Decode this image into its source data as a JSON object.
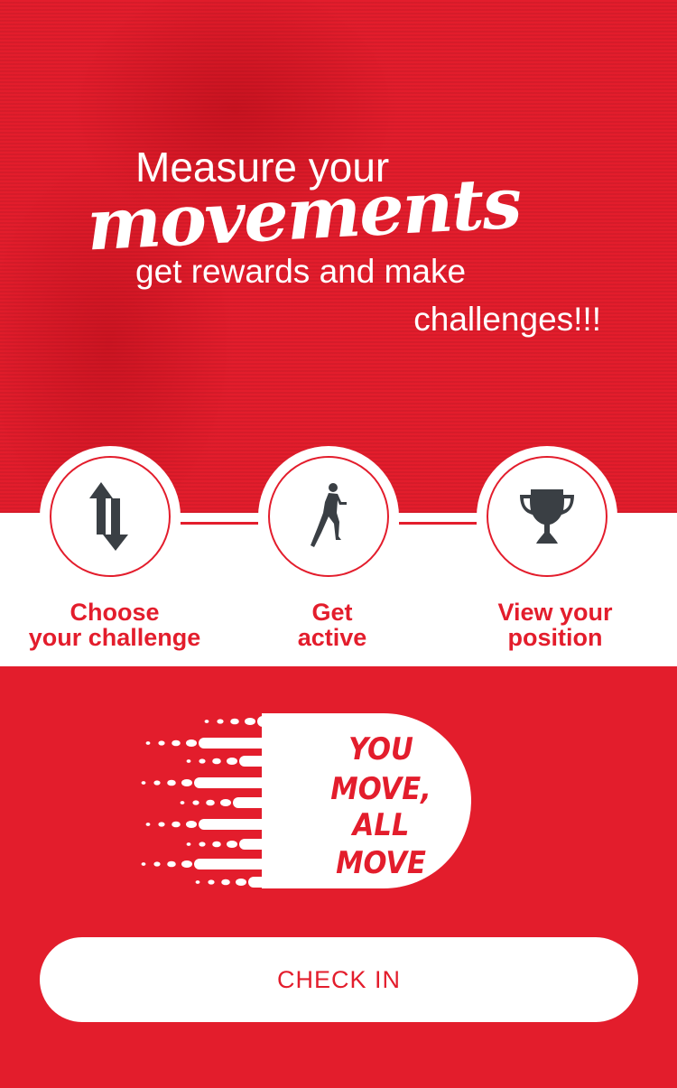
{
  "hero": {
    "line1": "Measure your",
    "line2": "movements",
    "line3": "get rewards and make",
    "line4": "challenges!!!"
  },
  "steps": [
    {
      "icon": "swap-arrows-icon",
      "line1": "Choose",
      "line2": "your challenge"
    },
    {
      "icon": "runner-icon",
      "line1": "Get",
      "line2": "active"
    },
    {
      "icon": "trophy-icon",
      "line1": "View your",
      "line2": "position"
    }
  ],
  "logo": {
    "text": "YOU MOVE, ALL MOVE"
  },
  "cta": {
    "label": "CHECK IN"
  },
  "colors": {
    "brand": "#e31d2c",
    "icon": "#3a3f44"
  }
}
